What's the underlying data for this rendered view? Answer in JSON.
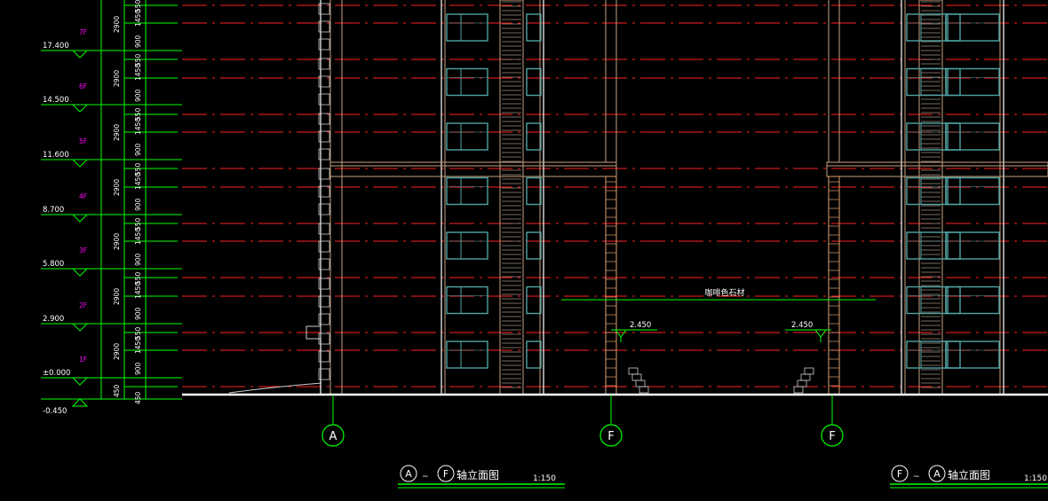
{
  "colors": {
    "background": "#000000",
    "dimension": "#00ff00",
    "floor_tag": "#ff00ff",
    "level_text": "#ffffff",
    "axis_line": "#ff2020",
    "structure": "#c8a080",
    "window": "#4fa3a3",
    "ground": "#ffffff"
  },
  "levels": [
    {
      "elev": "17.400",
      "floor": "7F"
    },
    {
      "elev": "14.500",
      "floor": "6F"
    },
    {
      "elev": "11.600",
      "floor": "5F"
    },
    {
      "elev": "8.700",
      "floor": "4F"
    },
    {
      "elev": "5.800",
      "floor": "3F"
    },
    {
      "elev": "2.900",
      "floor": "2F"
    },
    {
      "elev": "±0.000",
      "floor": "1F"
    },
    {
      "elev": "-0.450",
      "floor": ""
    }
  ],
  "dim_col1": [
    "2900",
    "2900",
    "2900",
    "2900",
    "2900",
    "2900",
    "2900",
    "450"
  ],
  "dim_col2": [
    "550",
    "1450",
    "900",
    "550",
    "1450",
    "900",
    "550",
    "1450",
    "900",
    "550",
    "1450",
    "900",
    "550",
    "1450",
    "900",
    "550",
    "1450",
    "900",
    "550",
    "1450",
    "900",
    "450"
  ],
  "axes": [
    {
      "label": "A"
    },
    {
      "label": "F"
    },
    {
      "label": "F"
    }
  ],
  "annotations": {
    "material": "咖啡色石材",
    "elev_left": "2.450",
    "elev_right": "2.450"
  },
  "titles": [
    {
      "from": "A",
      "to": "F",
      "text": "轴立面图",
      "scale": "1:150"
    },
    {
      "from": "F",
      "to": "A",
      "text": "轴立面图",
      "scale": "1:150"
    }
  ]
}
